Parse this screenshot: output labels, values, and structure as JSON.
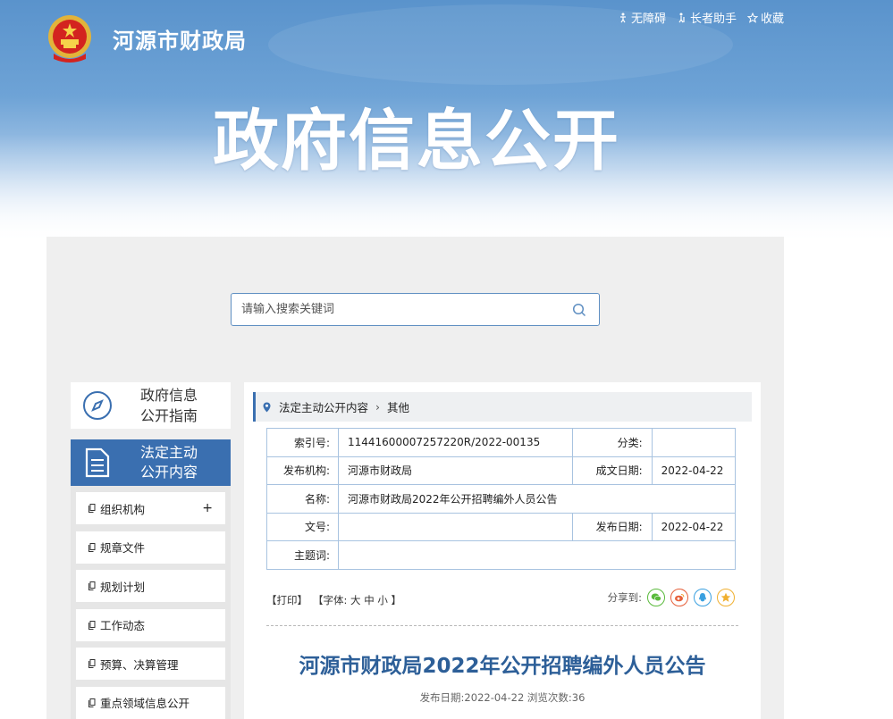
{
  "header": {
    "site_name": "河源市财政局",
    "hero_title": "政府信息公开",
    "links": [
      {
        "label": "无障碍",
        "icon": "accessibility-icon"
      },
      {
        "label": "长者助手",
        "icon": "elder-helper-icon"
      },
      {
        "label": "收藏",
        "icon": "star-icon"
      }
    ]
  },
  "search": {
    "placeholder": "请输入搜索关键词"
  },
  "sidebar": {
    "guide_label_1": "政府信息",
    "guide_label_2": "公开指南",
    "legal_label_1": "法定主动",
    "legal_label_2": "公开内容",
    "items": [
      {
        "label": "组织机构",
        "expandable": "+"
      },
      {
        "label": "规章文件"
      },
      {
        "label": "规划计划"
      },
      {
        "label": "工作动态"
      },
      {
        "label": "预算、决算管理"
      },
      {
        "label": "重点领域信息公开"
      }
    ]
  },
  "breadcrumb": {
    "section": "法定主动公开内容",
    "current": "其他"
  },
  "meta": {
    "index_label": "索引号:",
    "index_value": "11441600007257220R/2022-00135",
    "category_label": "分类:",
    "category_value": "",
    "publisher_label": "发布机构:",
    "publisher_value": "河源市财政局",
    "created_label": "成文日期:",
    "created_value": "2022-04-22",
    "name_label": "名称:",
    "name_value": "河源市财政局2022年公开招聘编外人员公告",
    "docno_label": "文号:",
    "docno_value": "",
    "published_label": "发布日期:",
    "published_value": "2022-04-22",
    "keywords_label": "主题词:",
    "keywords_value": ""
  },
  "tools": {
    "print": "【打印】",
    "font_prefix": "【字体:",
    "font_large": "大",
    "font_medium": "中",
    "font_small": "小",
    "font_suffix": "】",
    "share_label": "分享到:"
  },
  "article": {
    "title": "河源市财政局2022年公开招聘编外人员公告",
    "meta_line": "发布日期:2022-04-22  浏览次数:36"
  },
  "colors": {
    "accent": "#3a6fb0",
    "title_blue": "#2d5f98",
    "banner_top": "#5a93cc"
  }
}
